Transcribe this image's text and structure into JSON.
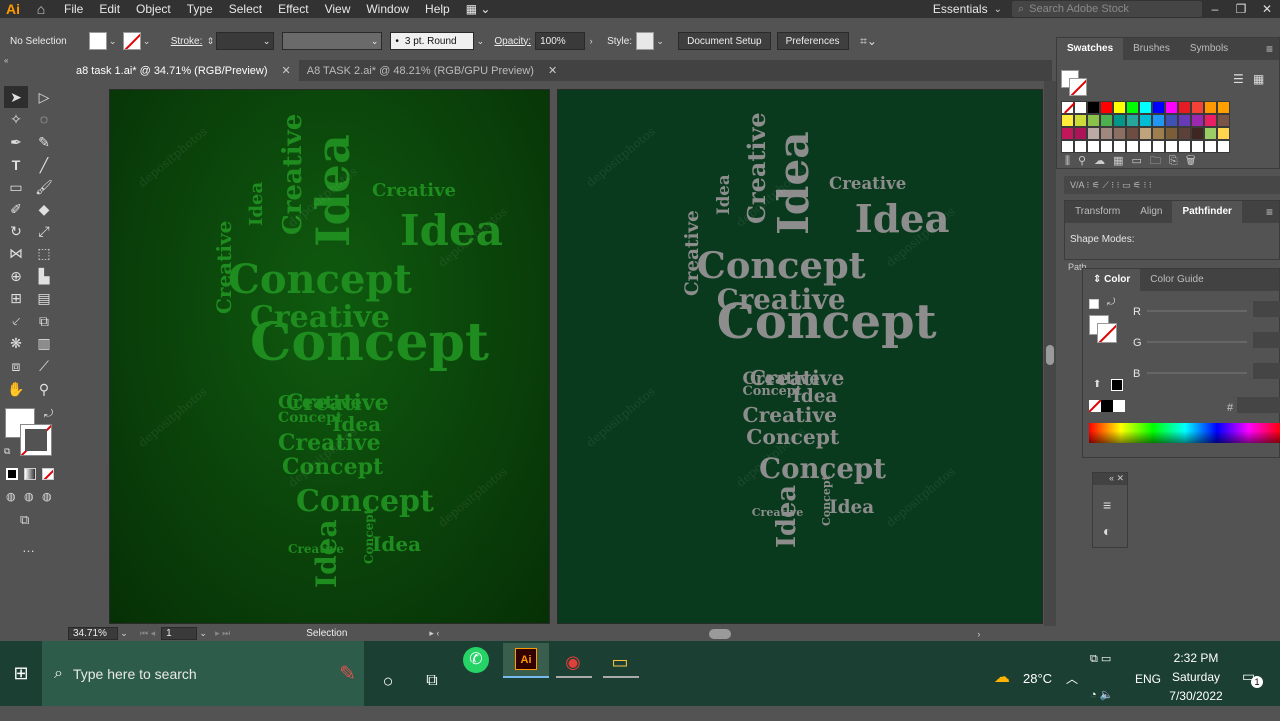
{
  "app": {
    "logo": "Ai"
  },
  "menu": {
    "items": [
      "File",
      "Edit",
      "Object",
      "Type",
      "Select",
      "Effect",
      "View",
      "Window",
      "Help"
    ],
    "workspace": "Essentials",
    "search_placeholder": "Search Adobe Stock"
  },
  "control": {
    "selection": "No Selection",
    "stroke_label": "Stroke:",
    "brush": "3 pt. Round",
    "opacity_label": "Opacity:",
    "opacity_value": "100%",
    "style_label": "Style:",
    "document_setup": "Document Setup",
    "preferences": "Preferences"
  },
  "tabs": [
    {
      "title": "a8 task 1.ai* @ 34.71% (RGB/Preview)",
      "active": true
    },
    {
      "title": "A8 TASK 2.ai* @ 48.21% (RGB/GPU Preview)",
      "active": false
    }
  ],
  "status": {
    "zoom": "34.71%",
    "page": "1",
    "mode": "Selection"
  },
  "panels": {
    "swatches_tabs": [
      "Swatches",
      "Brushes",
      "Symbols"
    ],
    "tfm_tabs": [
      "Transform",
      "Align",
      "Pathfinder"
    ],
    "shape_modes": "Shape Modes:",
    "pathfinders_stub": "Path",
    "color_tabs": [
      "Color",
      "Color Guide"
    ],
    "channels": [
      "R",
      "G",
      "B"
    ],
    "hex_label": "#"
  },
  "wordcloud": {
    "words": [
      "Idea",
      "Creative",
      "Concept",
      "Idea",
      "Creative",
      "Concept",
      "Creative",
      "Concept",
      "Creative",
      "Concept",
      "Idea",
      "Creative",
      "Concept",
      "Idea",
      "Creative",
      "Concept",
      "Idea",
      "Creative",
      "Creative",
      "Idea"
    ],
    "watermark": "depositphotos"
  },
  "taskbar": {
    "search_placeholder": "Type here to search",
    "weather": "28°C",
    "lang": "ENG",
    "time": "2:32 PM",
    "day": "Saturday",
    "date": "7/30/2022",
    "notifications": "1"
  },
  "colors": {
    "artboard1": "#0b4a0b",
    "artboard2": "#093a1d",
    "word_green": "#1f8c1f",
    "word_gray": "#8d8d8d",
    "taskbar": "#1c3f33"
  }
}
